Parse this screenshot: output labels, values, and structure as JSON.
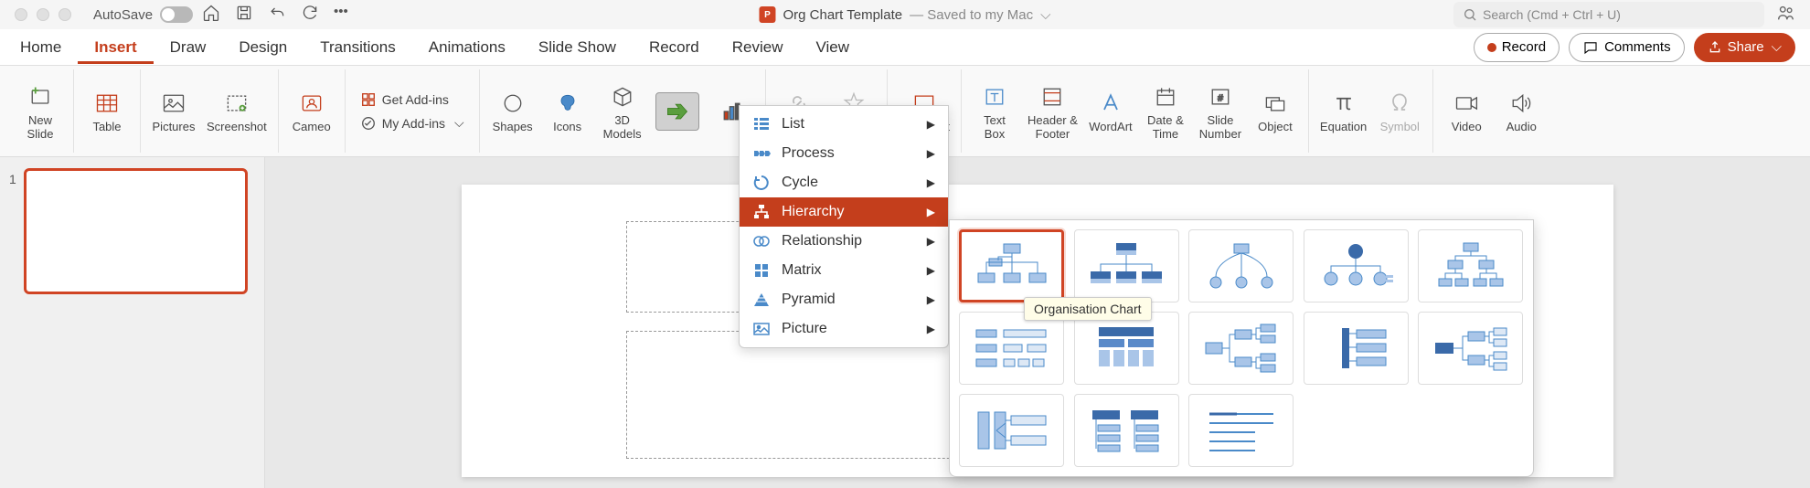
{
  "titlebar": {
    "autosave": "AutoSave",
    "doc_name": "Org Chart Template",
    "save_status": "— Saved to my Mac",
    "search_placeholder": "Search (Cmd + Ctrl + U)"
  },
  "tabs": {
    "home": "Home",
    "insert": "Insert",
    "draw": "Draw",
    "design": "Design",
    "transitions": "Transitions",
    "animations": "Animations",
    "slideshow": "Slide Show",
    "record_tab": "Record",
    "review": "Review",
    "view": "View"
  },
  "right_buttons": {
    "record": "Record",
    "comments": "Comments",
    "share": "Share"
  },
  "ribbon": {
    "new_slide": "New\nSlide",
    "table": "Table",
    "pictures": "Pictures",
    "screenshot": "Screenshot",
    "cameo": "Cameo",
    "get_addins": "Get Add-ins",
    "my_addins": "My Add-ins",
    "shapes": "Shapes",
    "icons": "Icons",
    "models": "3D\nModels",
    "link": "Link",
    "action": "Action",
    "comment": "Comment",
    "textbox": "Text\nBox",
    "headerfooter": "Header &\nFooter",
    "wordart": "WordArt",
    "datetime": "Date &\nTime",
    "slideno": "Slide\nNumber",
    "object": "Object",
    "equation": "Equation",
    "symbol": "Symbol",
    "video": "Video",
    "audio": "Audio"
  },
  "smartart_menu": {
    "list": "List",
    "process": "Process",
    "cycle": "Cycle",
    "hierarchy": "Hierarchy",
    "relationship": "Relationship",
    "matrix": "Matrix",
    "pyramid": "Pyramid",
    "picture": "Picture"
  },
  "tooltip": "Organisation Chart",
  "thumb_index": "1"
}
